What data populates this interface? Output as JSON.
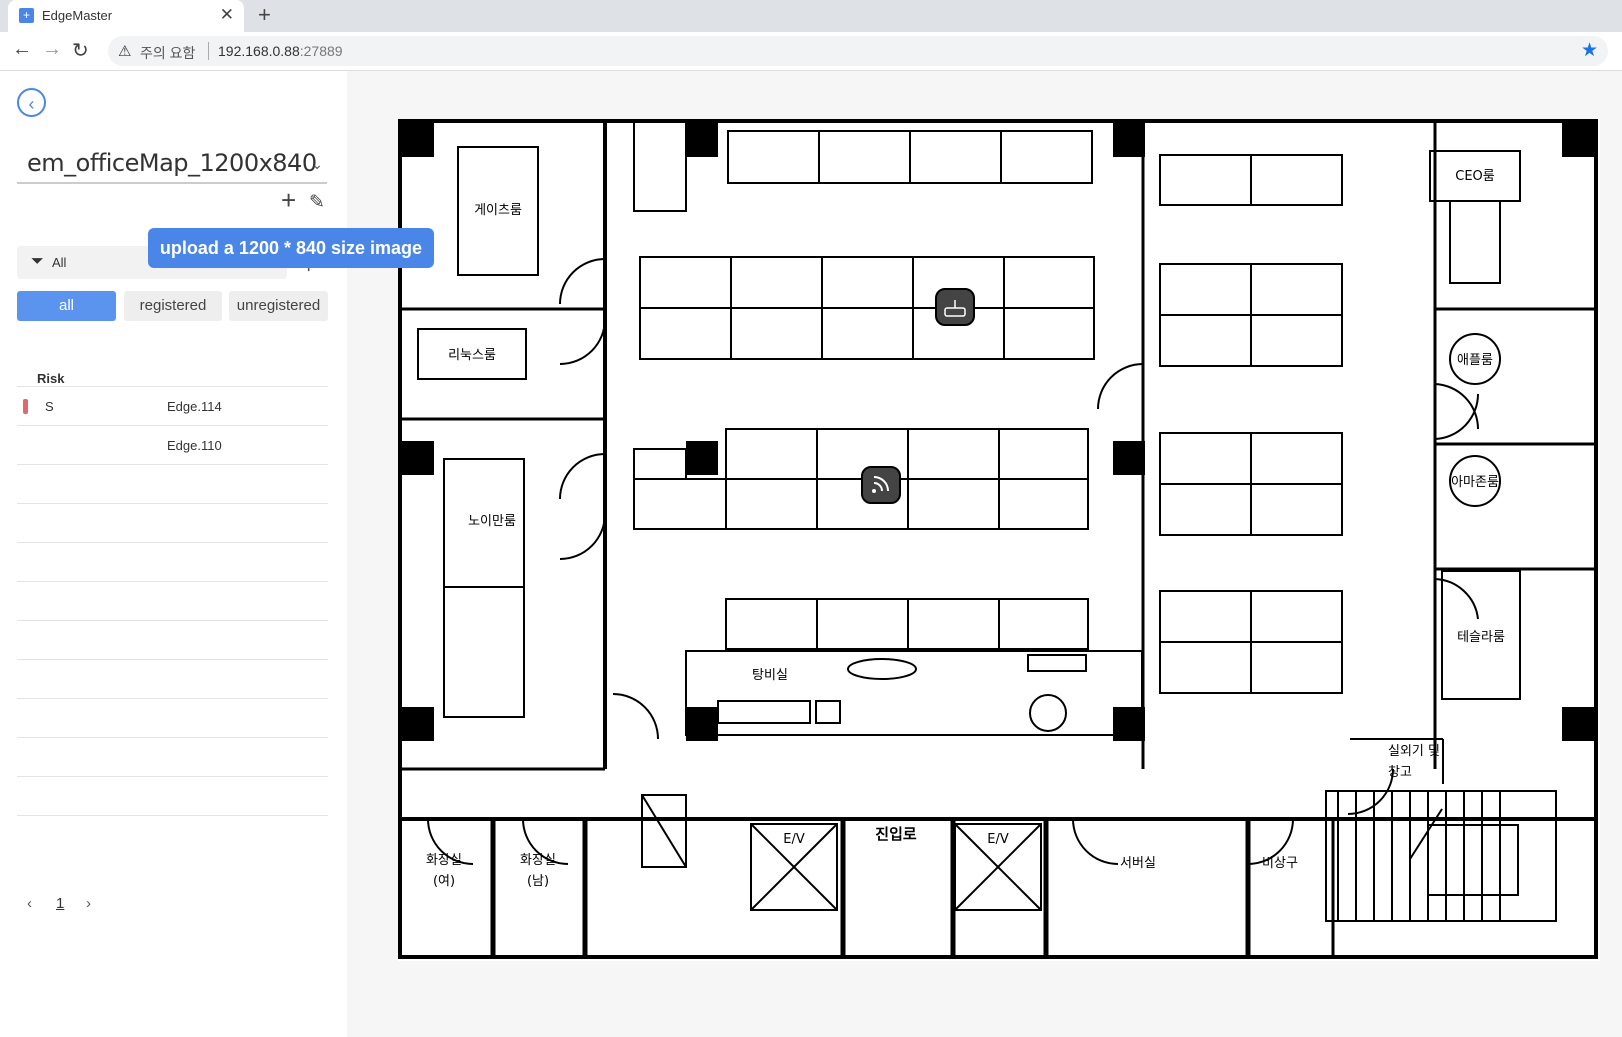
{
  "browser": {
    "tab_title": "EdgeMaster",
    "tab_close": "✕",
    "new_tab": "+",
    "security_text": "주의 요함",
    "url_host": "192.168.0.88",
    "url_port": ":27889"
  },
  "sidebar": {
    "map_name": "em_officeMap_1200x840",
    "tooltip": "upload a 1200 * 840 size image",
    "filter_label": "All",
    "segments": {
      "all": "all",
      "registered": "registered",
      "unregistered": "unregistered"
    },
    "column_risk": "Risk",
    "devices": [
      {
        "risk": "S",
        "name": "Edge.114",
        "risk_color": "#e06a6a"
      },
      {
        "risk": "",
        "name": "Edge.110"
      }
    ],
    "pagination": {
      "current": "1"
    }
  },
  "floorplan": {
    "rooms": {
      "game": "게이츠룸",
      "linux": "리눅스룸",
      "noiman": "노이만룸",
      "ceo": "CEO룸",
      "apple": "애플룸",
      "amazon": "아마존룸",
      "tesla": "테슬라룸",
      "pantry": "탕비실",
      "outdoor_line1": "실외기 및",
      "outdoor_line2": "창고",
      "restroom_women_line1": "화장실",
      "restroom_women_line2": "(여)",
      "restroom_men_line1": "화장실",
      "restroom_men_line2": "(남)",
      "ev_left": "E/V",
      "ev_right": "E/V",
      "entrance": "진입로",
      "server": "서버실",
      "emergency": "비상구"
    },
    "markers": [
      {
        "type": "router",
        "icon": "router-icon"
      },
      {
        "type": "wireless",
        "icon": "rss-icon"
      }
    ]
  },
  "colors": {
    "accent": "#4a86e8",
    "risk": "#e06a6a"
  }
}
